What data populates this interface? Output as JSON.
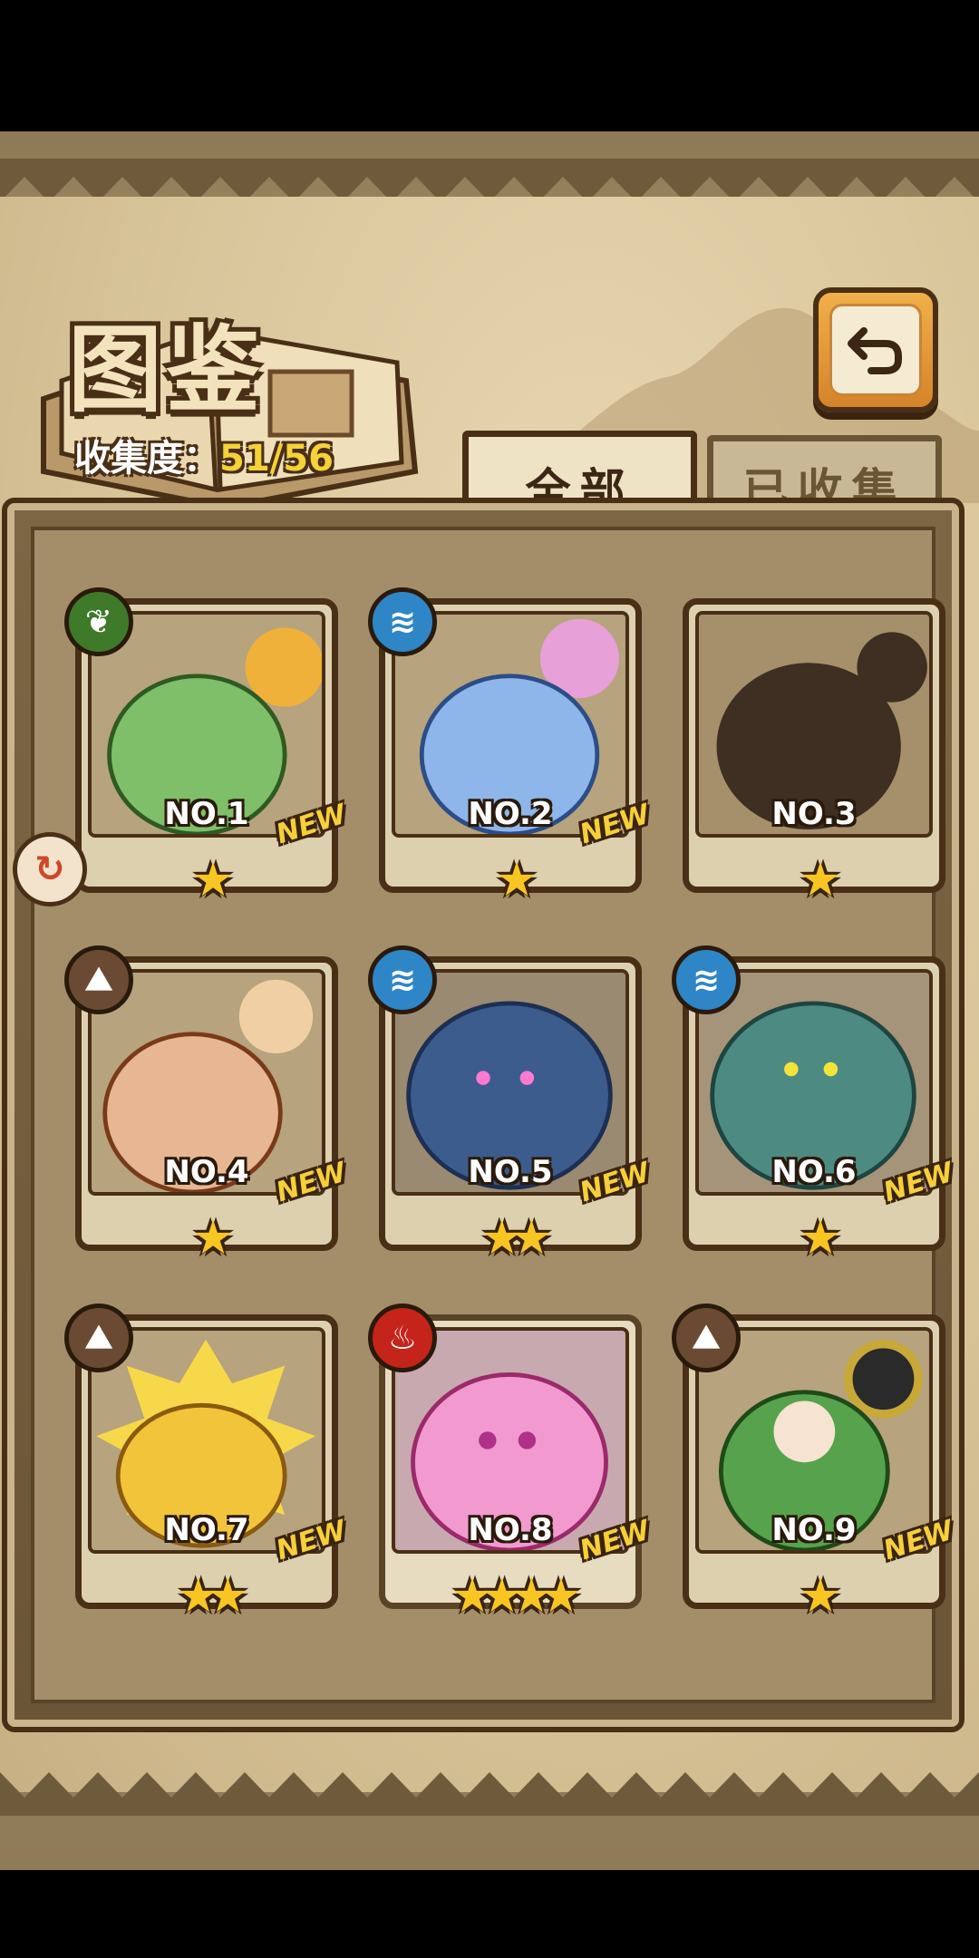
{
  "header": {
    "title": "图鉴",
    "collection_label": "收集度：",
    "collection_value": "51/56"
  },
  "tabs": [
    {
      "label": "全部",
      "active": true
    },
    {
      "label": "已收集",
      "active": false
    }
  ],
  "icons": {
    "back": "return-arrow-icon",
    "side": "turn-arrow-icon"
  },
  "colors": {
    "star": "#f7c623",
    "new_tag": "#f6cf3a",
    "element_grass": "#3f7a2a",
    "element_water": "#2f86c6",
    "element_earth": "#6b4a34",
    "element_fire": "#c4241a"
  },
  "cards": [
    {
      "no": "NO.1",
      "element": "grass",
      "element_icon": "leaf-icon",
      "stars": "★",
      "new": "NEW",
      "color": "#7fbf6a"
    },
    {
      "no": "NO.2",
      "element": "water",
      "element_icon": "water-waves-icon",
      "stars": "★",
      "new": "NEW",
      "color": "#8eb6ea"
    },
    {
      "no": "NO.3",
      "element": "",
      "element_icon": "",
      "stars": "★",
      "new": "",
      "color": "#3f2f22"
    },
    {
      "no": "NO.4",
      "element": "earth",
      "element_icon": "mountain-icon",
      "stars": "★",
      "new": "NEW",
      "color": "#e6b792"
    },
    {
      "no": "NO.5",
      "element": "water",
      "element_icon": "water-waves-icon",
      "stars": "★★",
      "new": "NEW",
      "color": "#3b5c8c"
    },
    {
      "no": "NO.6",
      "element": "water",
      "element_icon": "water-waves-icon",
      "stars": "★",
      "new": "NEW",
      "color": "#4d8a82"
    },
    {
      "no": "NO.7",
      "element": "earth",
      "element_icon": "mountain-icon",
      "stars": "★★",
      "new": "NEW",
      "color": "#f2c43a"
    },
    {
      "no": "NO.8",
      "element": "fire",
      "element_icon": "flame-icon",
      "stars": "★★★★",
      "new": "NEW",
      "color": "#f29ad0"
    },
    {
      "no": "NO.9",
      "element": "earth",
      "element_icon": "mountain-icon",
      "stars": "★",
      "new": "NEW",
      "color": "#57a24c"
    }
  ]
}
